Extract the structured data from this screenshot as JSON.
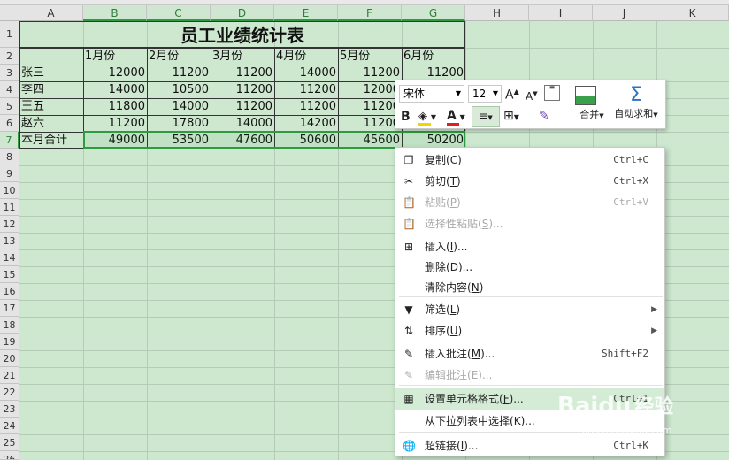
{
  "columns": [
    "A",
    "B",
    "C",
    "D",
    "E",
    "F",
    "G",
    "H",
    "I",
    "J",
    "K"
  ],
  "rows": [
    "1",
    "2",
    "3",
    "4",
    "5",
    "6",
    "7",
    "8",
    "9",
    "10",
    "11",
    "12",
    "13",
    "14",
    "15",
    "16",
    "17",
    "18",
    "19",
    "20",
    "21",
    "22",
    "23",
    "24",
    "25",
    "26"
  ],
  "sheet": {
    "title": "员工业绩统计表",
    "months": [
      "1月份",
      "2月份",
      "3月份",
      "4月份",
      "5月份",
      "6月份"
    ],
    "data": [
      {
        "name": "张三",
        "values": [
          "12000",
          "11200",
          "11200",
          "14000",
          "11200",
          "11200"
        ]
      },
      {
        "name": "李四",
        "values": [
          "14000",
          "10500",
          "11200",
          "11200",
          "12000",
          ""
        ]
      },
      {
        "name": "王五",
        "values": [
          "11800",
          "14000",
          "11200",
          "11200",
          "11200",
          ""
        ]
      },
      {
        "name": "赵六",
        "values": [
          "11200",
          "17800",
          "14000",
          "14200",
          "11200",
          ""
        ]
      }
    ],
    "total": {
      "name": "本月合计",
      "values": [
        "49000",
        "53500",
        "47600",
        "50600",
        "45600",
        "50200"
      ]
    }
  },
  "format_bar": {
    "font": "宋体",
    "size": "12",
    "grow_font": "A",
    "shrink_font": "A",
    "bold": "B",
    "font_color": "A",
    "merge": "合并",
    "autosum": "自动求和"
  },
  "context_menu": [
    {
      "icon": "copy-icon",
      "glyph": "❐",
      "label": "复制",
      "key": "C",
      "shortcut": "Ctrl+C",
      "disabled": false
    },
    {
      "icon": "scissors-icon",
      "glyph": "✂",
      "label": "剪切",
      "key": "T",
      "shortcut": "Ctrl+X",
      "disabled": false
    },
    {
      "icon": "paste-icon",
      "glyph": "📋",
      "label": "粘贴",
      "key": "P",
      "shortcut": "Ctrl+V",
      "disabled": true
    },
    {
      "icon": "paste-special-icon",
      "glyph": "📋",
      "label": "选择性粘贴",
      "key": "S",
      "suffix": "...",
      "shortcut": "",
      "disabled": true
    },
    {
      "icon": "insert-icon",
      "glyph": "⊞",
      "label": "插入",
      "key": "I",
      "suffix": "...",
      "shortcut": "",
      "disabled": false
    },
    {
      "icon": "",
      "glyph": "",
      "label": "删除",
      "key": "D",
      "suffix": "...",
      "shortcut": "",
      "disabled": false
    },
    {
      "icon": "",
      "glyph": "",
      "label": "清除内容",
      "key": "N",
      "shortcut": "",
      "disabled": false
    },
    {
      "icon": "filter-icon",
      "glyph": "▼",
      "label": "筛选",
      "key": "L",
      "shortcut": "",
      "disabled": false,
      "submenu": true
    },
    {
      "icon": "sort-icon",
      "glyph": "⇅",
      "label": "排序",
      "key": "U",
      "shortcut": "",
      "disabled": false,
      "submenu": true
    },
    {
      "icon": "insert-comment-icon",
      "glyph": "✎",
      "label": "插入批注",
      "key": "M",
      "suffix": "...",
      "shortcut": "Shift+F2",
      "disabled": false
    },
    {
      "icon": "edit-comment-icon",
      "glyph": "✎",
      "label": "编辑批注",
      "key": "E",
      "suffix": "...",
      "shortcut": "",
      "disabled": true
    },
    {
      "icon": "format-cells-icon",
      "glyph": "▦",
      "label": "设置单元格格式",
      "key": "F",
      "suffix": "...",
      "shortcut": "Ctrl+1",
      "disabled": false,
      "hover": true
    },
    {
      "icon": "",
      "glyph": "",
      "label": "从下拉列表中选择",
      "key": "K",
      "suffix": "...",
      "shortcut": "",
      "disabled": false
    },
    {
      "icon": "hyperlink-icon",
      "glyph": "🌐",
      "label": "超链接",
      "key": "I",
      "suffix": "...",
      "shortcut": "Ctrl+K",
      "disabled": false
    }
  ],
  "watermark": {
    "brand": "Baidu",
    "suffix": "经验",
    "url": "jingyan.baidu.com"
  },
  "colors": {
    "accent": "#2f9a41",
    "grid": "#cde8cf",
    "hover": "#d4ecd6"
  }
}
